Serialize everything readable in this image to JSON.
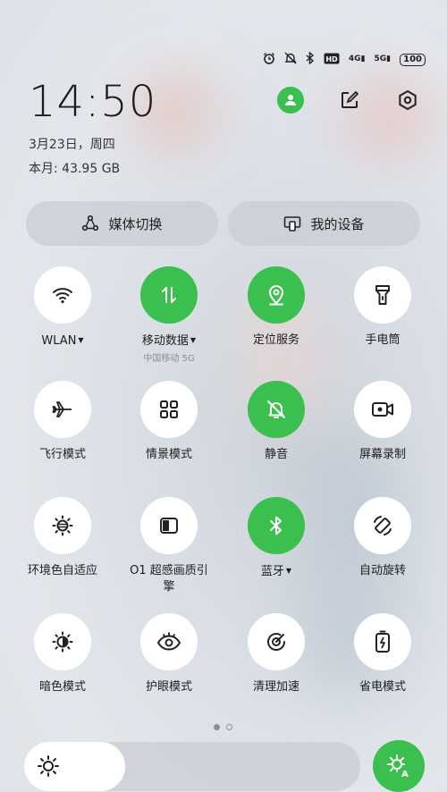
{
  "header": {
    "time": "14:50",
    "date": "3月23日，周四",
    "usage": "本月: 43.95 GB"
  },
  "status_bar": {
    "signal_4g": "4G",
    "signal_5g": "5G",
    "battery": "100",
    "icons": [
      "alarm-icon",
      "mute-icon",
      "bluetooth-icon",
      "hd-icon",
      "signal-icon"
    ]
  },
  "pills": {
    "media_switch": "媒体切换",
    "my_devices": "我的设备"
  },
  "tiles": [
    {
      "label": "WLAN",
      "sub": "",
      "on": false,
      "caret": true,
      "icon": "wifi-icon"
    },
    {
      "label": "移动数据",
      "sub": "中国移动 5G",
      "on": true,
      "caret": true,
      "icon": "data-arrows-icon"
    },
    {
      "label": "定位服务",
      "sub": "",
      "on": true,
      "caret": false,
      "icon": "location-icon"
    },
    {
      "label": "手电筒",
      "sub": "",
      "on": false,
      "caret": false,
      "icon": "flashlight-icon"
    },
    {
      "label": "飞行模式",
      "sub": "",
      "on": false,
      "caret": false,
      "icon": "airplane-icon"
    },
    {
      "label": "情景模式",
      "sub": "",
      "on": false,
      "caret": false,
      "icon": "grid-icon"
    },
    {
      "label": "静音",
      "sub": "",
      "on": true,
      "caret": false,
      "icon": "bell-off-icon"
    },
    {
      "label": "屏幕录制",
      "sub": "",
      "on": false,
      "caret": false,
      "icon": "video-record-icon"
    },
    {
      "label": "环境色自适应",
      "sub": "",
      "on": false,
      "caret": false,
      "icon": "ambient-light-icon"
    },
    {
      "label": "O1 超感画质引擎",
      "sub": "",
      "on": false,
      "caret": false,
      "icon": "display-engine-icon"
    },
    {
      "label": "蓝牙",
      "sub": "",
      "on": true,
      "caret": true,
      "icon": "bluetooth-icon"
    },
    {
      "label": "自动旋转",
      "sub": "",
      "on": false,
      "caret": false,
      "icon": "rotate-icon"
    },
    {
      "label": "暗色模式",
      "sub": "",
      "on": false,
      "caret": false,
      "icon": "dark-mode-icon"
    },
    {
      "label": "护眼模式",
      "sub": "",
      "on": false,
      "caret": false,
      "icon": "eye-icon"
    },
    {
      "label": "清理加速",
      "sub": "",
      "on": false,
      "caret": false,
      "icon": "clean-boost-icon"
    },
    {
      "label": "省电模式",
      "sub": "",
      "on": false,
      "caret": false,
      "icon": "battery-saver-icon"
    }
  ],
  "pager": {
    "current": 1,
    "total": 2
  },
  "brightness": {
    "level": 0.3
  },
  "colors": {
    "accent": "#3bbf4f",
    "tile_off": "#ffffff"
  }
}
